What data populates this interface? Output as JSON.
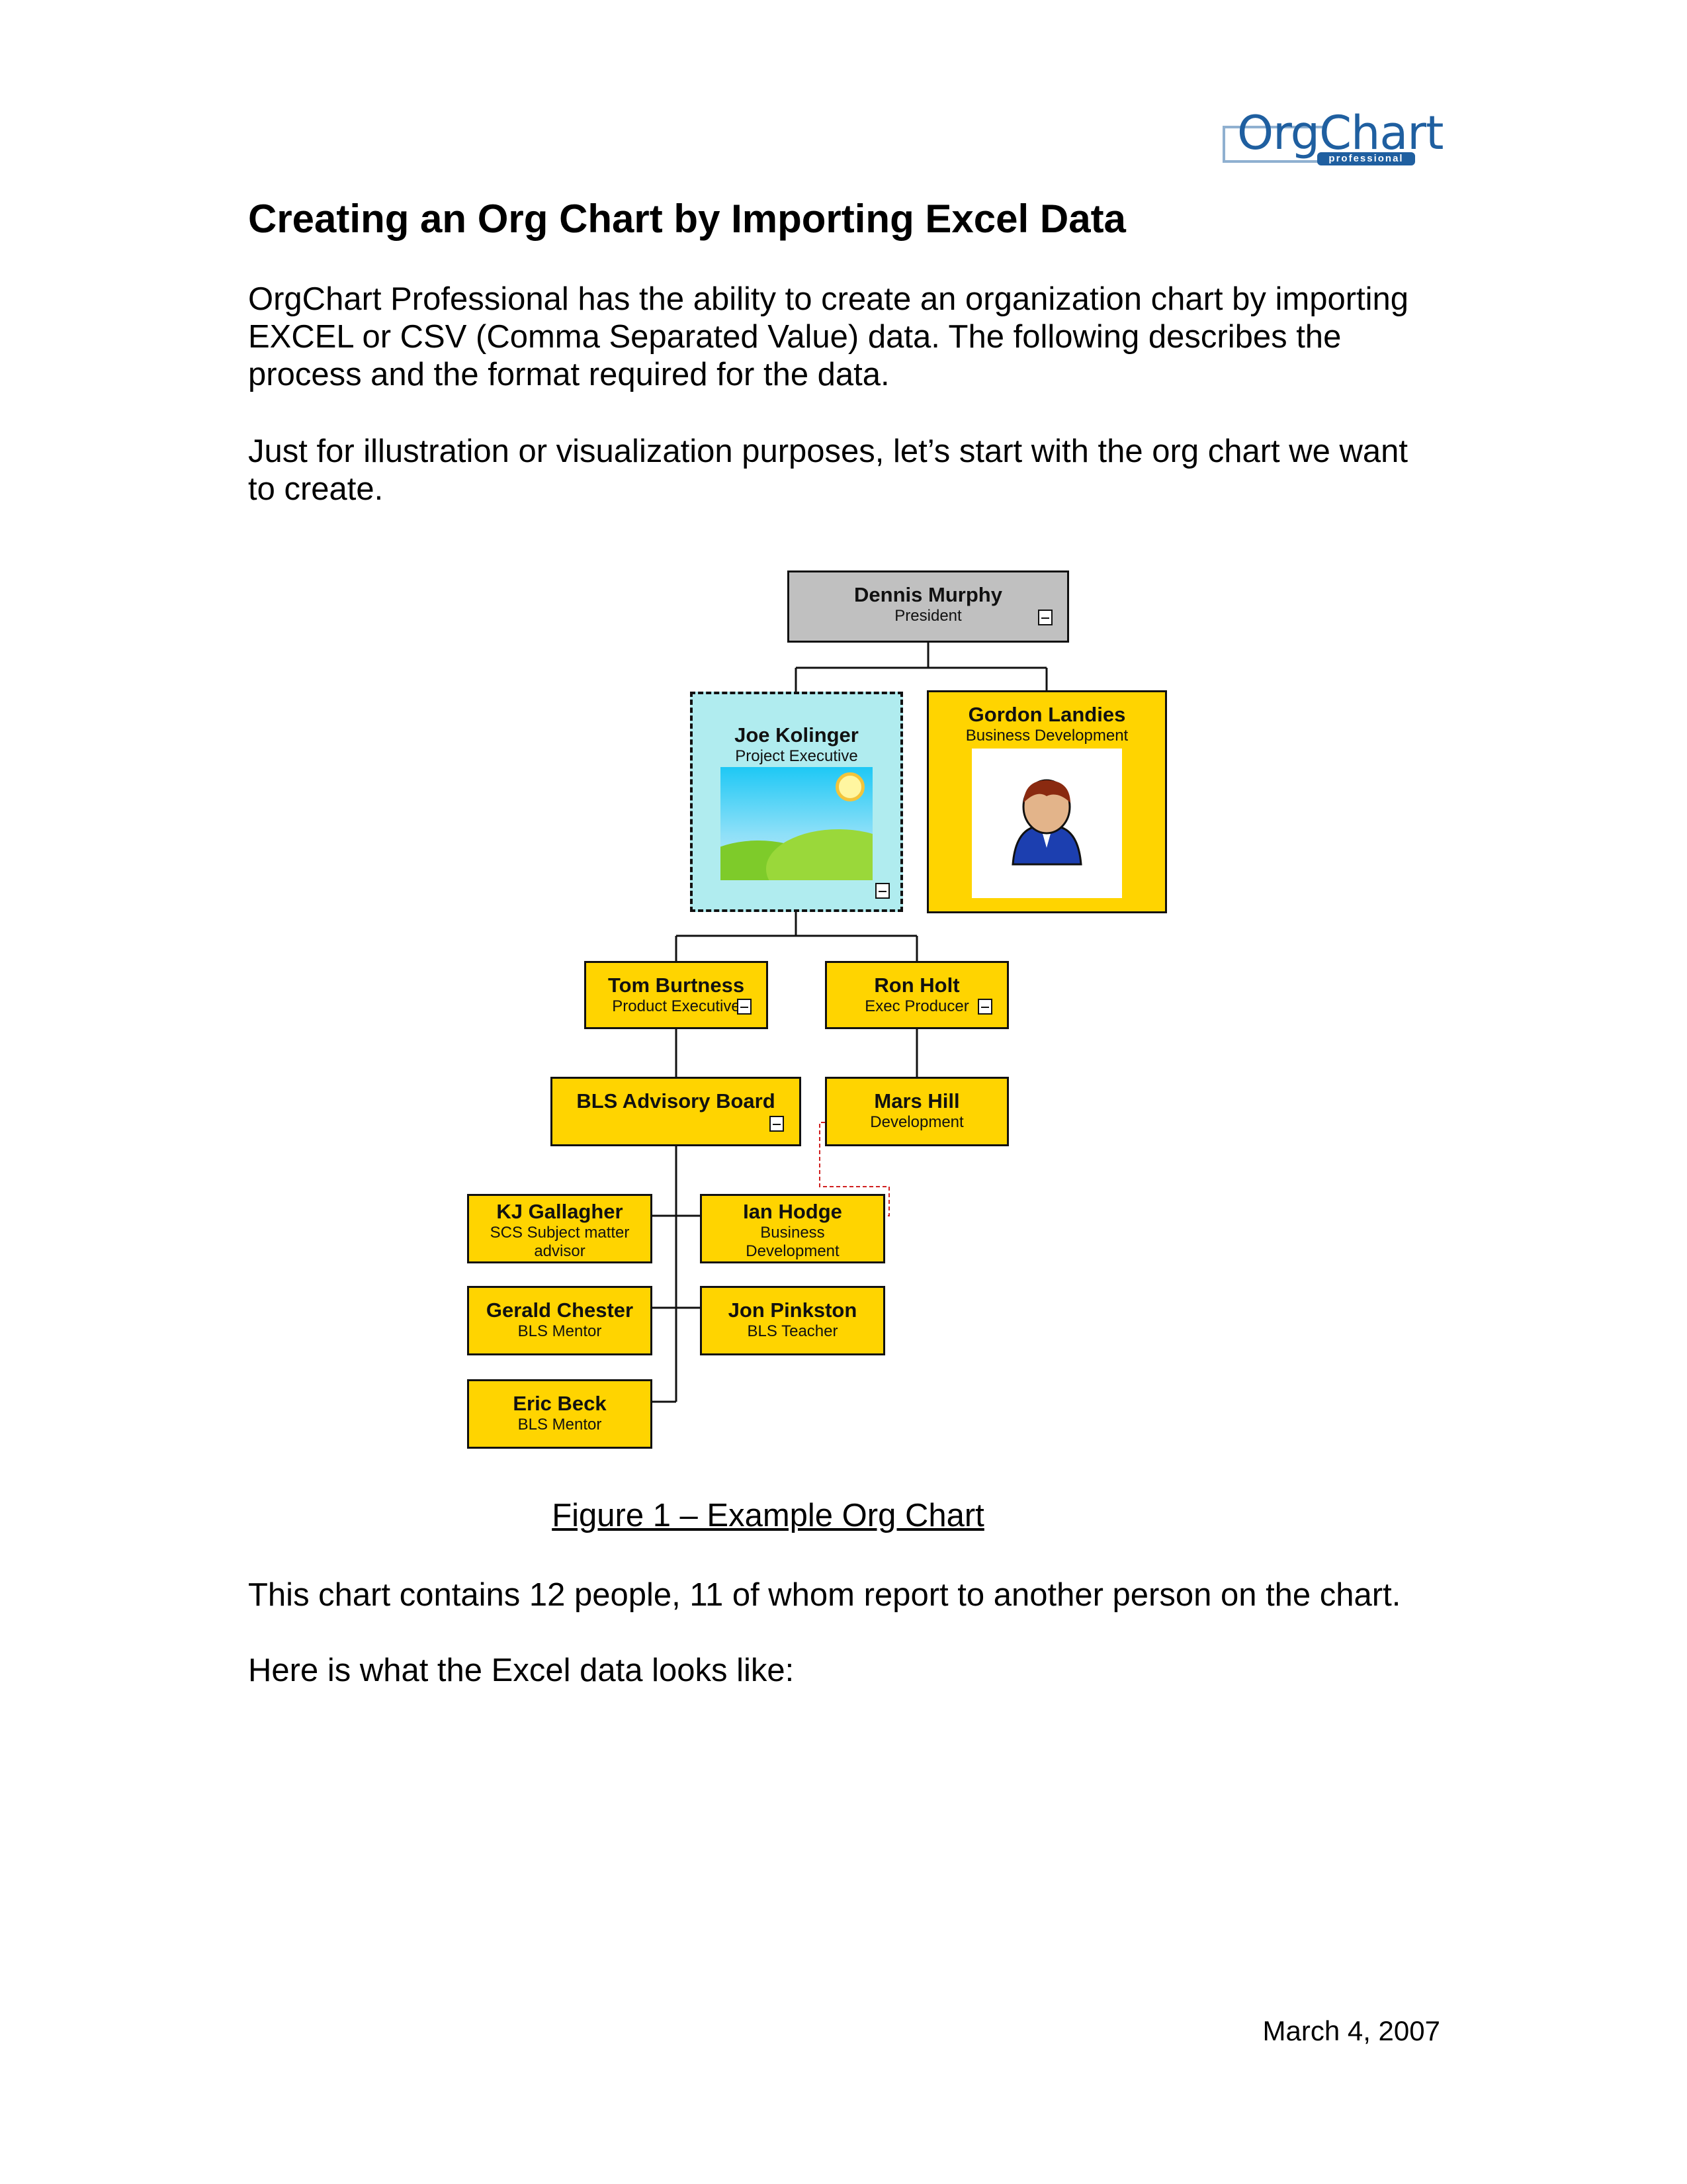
{
  "logo": {
    "text": "OrgChart",
    "subtext": "professional",
    "color": "#1f5fa0"
  },
  "title": "Creating an Org Chart by Importing Excel Data",
  "intro": {
    "lines": [
      "OrgChart Professional has the ability to create an organization chart by importing",
      "EXCEL or CSV (Comma Separated Value) data. The following describes the",
      "process and the format required for the data."
    ]
  },
  "illustration": {
    "lines": [
      "Just for illustration or visualization purposes, let’s start with the org chart we want",
      "to create."
    ]
  },
  "org_chart": {
    "colors": {
      "node": "#ffd400",
      "root": "#c0c0c0",
      "selected": "#b0ecef",
      "dotted_line": "#d02020"
    },
    "nodes": [
      {
        "name": "Dennis Murphy",
        "title": "President"
      },
      {
        "name": "Joe Kolinger",
        "title": "Project Executive"
      },
      {
        "name": "Gordon Landies",
        "title": "Business Development"
      },
      {
        "name": "Tom Burtness",
        "title": "Product Executive"
      },
      {
        "name": "Ron Holt",
        "title": "Exec Producer"
      },
      {
        "name": "BLS Advisory Board",
        "title": ""
      },
      {
        "name": "Mars Hill",
        "title": "Development"
      },
      {
        "name": "KJ Gallagher",
        "title": "SCS Subject matter advisor"
      },
      {
        "name": "Ian Hodge",
        "title": "Business Development"
      },
      {
        "name": "Gerald Chester",
        "title": "BLS Mentor"
      },
      {
        "name": "Jon Pinkston",
        "title": "BLS Teacher"
      },
      {
        "name": "Eric Beck",
        "title": "BLS Mentor"
      }
    ]
  },
  "caption": "Figure 1 – Example Org Chart",
  "summary": "This chart contains 12 people, 11 of whom report to another person on the chart.",
  "excel_intro": "Here is what the Excel data looks like:",
  "footer": {
    "date": "March 4, 2007"
  }
}
